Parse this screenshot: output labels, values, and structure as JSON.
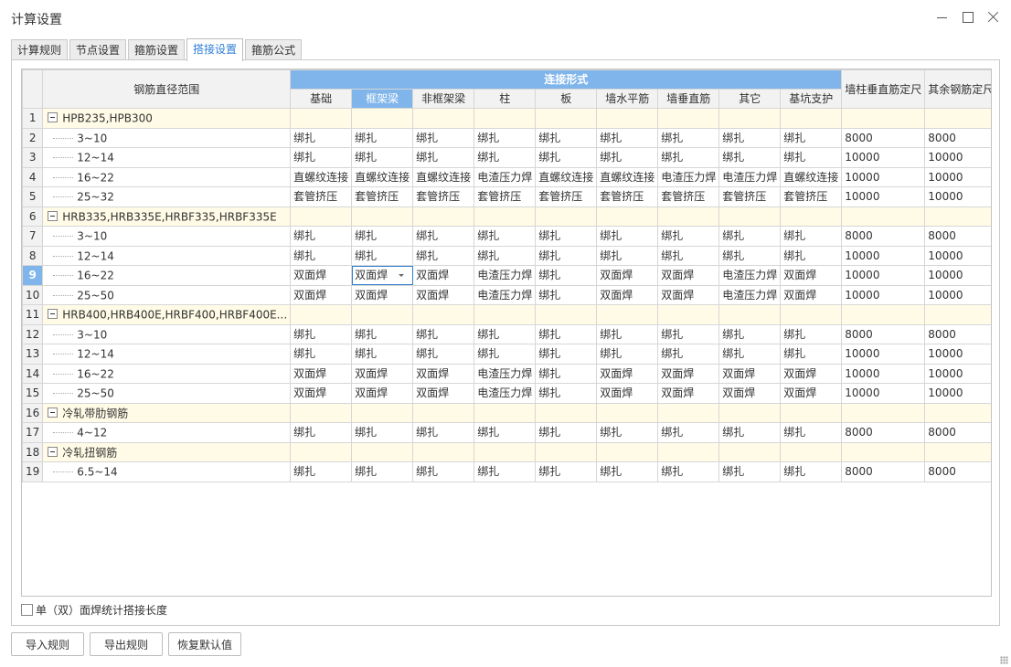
{
  "window": {
    "title": "计算设置"
  },
  "tabs": [
    {
      "label": "计算规则",
      "active": false
    },
    {
      "label": "节点设置",
      "active": false
    },
    {
      "label": "箍筋设置",
      "active": false
    },
    {
      "label": "搭接设置",
      "active": true
    },
    {
      "label": "箍筋公式",
      "active": false
    }
  ],
  "grid": {
    "header": {
      "range": "钢筋直径范围",
      "group": "连接形式",
      "columns": [
        "基础",
        "框架梁",
        "非框架梁",
        "柱",
        "板",
        "墙水平筋",
        "墙垂直筋",
        "其它",
        "基坑支护"
      ],
      "wall_col": "墙柱垂直筋定尺",
      "other_col": "其余钢筋定尺",
      "selected_column": 1
    },
    "selected_row": 9,
    "editing_cell": {
      "row": 9,
      "col": 1
    },
    "rows": [
      {
        "no": "1",
        "type": "group",
        "label": "HPB235,HPB300"
      },
      {
        "no": "2",
        "type": "item",
        "label": "3~10",
        "values": [
          "绑扎",
          "绑扎",
          "绑扎",
          "绑扎",
          "绑扎",
          "绑扎",
          "绑扎",
          "绑扎",
          "绑扎"
        ],
        "wall": "8000",
        "other": "8000"
      },
      {
        "no": "3",
        "type": "item",
        "label": "12~14",
        "values": [
          "绑扎",
          "绑扎",
          "绑扎",
          "绑扎",
          "绑扎",
          "绑扎",
          "绑扎",
          "绑扎",
          "绑扎"
        ],
        "wall": "10000",
        "other": "10000"
      },
      {
        "no": "4",
        "type": "item",
        "label": "16~22",
        "values": [
          "直螺纹连接",
          "直螺纹连接",
          "直螺纹连接",
          "电渣压力焊",
          "直螺纹连接",
          "直螺纹连接",
          "电渣压力焊",
          "电渣压力焊",
          "直螺纹连接"
        ],
        "wall": "10000",
        "other": "10000"
      },
      {
        "no": "5",
        "type": "item",
        "label": "25~32",
        "values": [
          "套管挤压",
          "套管挤压",
          "套管挤压",
          "套管挤压",
          "套管挤压",
          "套管挤压",
          "套管挤压",
          "套管挤压",
          "套管挤压"
        ],
        "wall": "10000",
        "other": "10000"
      },
      {
        "no": "6",
        "type": "group",
        "label": "HRB335,HRB335E,HRBF335,HRBF335E"
      },
      {
        "no": "7",
        "type": "item",
        "label": "3~10",
        "values": [
          "绑扎",
          "绑扎",
          "绑扎",
          "绑扎",
          "绑扎",
          "绑扎",
          "绑扎",
          "绑扎",
          "绑扎"
        ],
        "wall": "8000",
        "other": "8000"
      },
      {
        "no": "8",
        "type": "item",
        "label": "12~14",
        "values": [
          "绑扎",
          "绑扎",
          "绑扎",
          "绑扎",
          "绑扎",
          "绑扎",
          "绑扎",
          "绑扎",
          "绑扎"
        ],
        "wall": "10000",
        "other": "10000"
      },
      {
        "no": "9",
        "type": "item",
        "label": "16~22",
        "values": [
          "双面焊",
          "双面焊",
          "双面焊",
          "电渣压力焊",
          "绑扎",
          "双面焊",
          "双面焊",
          "电渣压力焊",
          "双面焊"
        ],
        "wall": "10000",
        "other": "10000"
      },
      {
        "no": "10",
        "type": "item",
        "label": "25~50",
        "values": [
          "双面焊",
          "双面焊",
          "双面焊",
          "电渣压力焊",
          "绑扎",
          "双面焊",
          "双面焊",
          "电渣压力焊",
          "双面焊"
        ],
        "wall": "10000",
        "other": "10000"
      },
      {
        "no": "11",
        "type": "group",
        "label": "HRB400,HRB400E,HRBF400,HRBF400E..."
      },
      {
        "no": "12",
        "type": "item",
        "label": "3~10",
        "values": [
          "绑扎",
          "绑扎",
          "绑扎",
          "绑扎",
          "绑扎",
          "绑扎",
          "绑扎",
          "绑扎",
          "绑扎"
        ],
        "wall": "8000",
        "other": "8000"
      },
      {
        "no": "13",
        "type": "item",
        "label": "12~14",
        "values": [
          "绑扎",
          "绑扎",
          "绑扎",
          "绑扎",
          "绑扎",
          "绑扎",
          "绑扎",
          "绑扎",
          "绑扎"
        ],
        "wall": "10000",
        "other": "10000"
      },
      {
        "no": "14",
        "type": "item",
        "label": "16~22",
        "values": [
          "双面焊",
          "双面焊",
          "双面焊",
          "电渣压力焊",
          "绑扎",
          "双面焊",
          "双面焊",
          "双面焊",
          "双面焊"
        ],
        "wall": "10000",
        "other": "10000"
      },
      {
        "no": "15",
        "type": "item",
        "label": "25~50",
        "values": [
          "双面焊",
          "双面焊",
          "双面焊",
          "电渣压力焊",
          "绑扎",
          "双面焊",
          "双面焊",
          "双面焊",
          "双面焊"
        ],
        "wall": "10000",
        "other": "10000"
      },
      {
        "no": "16",
        "type": "group",
        "label": "冷轧带肋钢筋"
      },
      {
        "no": "17",
        "type": "item",
        "label": "4~12",
        "values": [
          "绑扎",
          "绑扎",
          "绑扎",
          "绑扎",
          "绑扎",
          "绑扎",
          "绑扎",
          "绑扎",
          "绑扎"
        ],
        "wall": "8000",
        "other": "8000"
      },
      {
        "no": "18",
        "type": "group",
        "label": "冷轧扭钢筋"
      },
      {
        "no": "19",
        "type": "item",
        "label": "6.5~14",
        "values": [
          "绑扎",
          "绑扎",
          "绑扎",
          "绑扎",
          "绑扎",
          "绑扎",
          "绑扎",
          "绑扎",
          "绑扎"
        ],
        "wall": "8000",
        "other": "8000"
      }
    ]
  },
  "options": {
    "weld_length_label": "单（双）面焊统计搭接长度",
    "weld_length_checked": false
  },
  "buttons": {
    "import": "导入规则",
    "export": "导出规则",
    "restore": "恢复默认值"
  },
  "icons": [
    "minimize-icon",
    "maximize-icon",
    "close-icon",
    "collapse-icon",
    "dropdown-arrow-icon",
    "resize-grip-icon"
  ]
}
